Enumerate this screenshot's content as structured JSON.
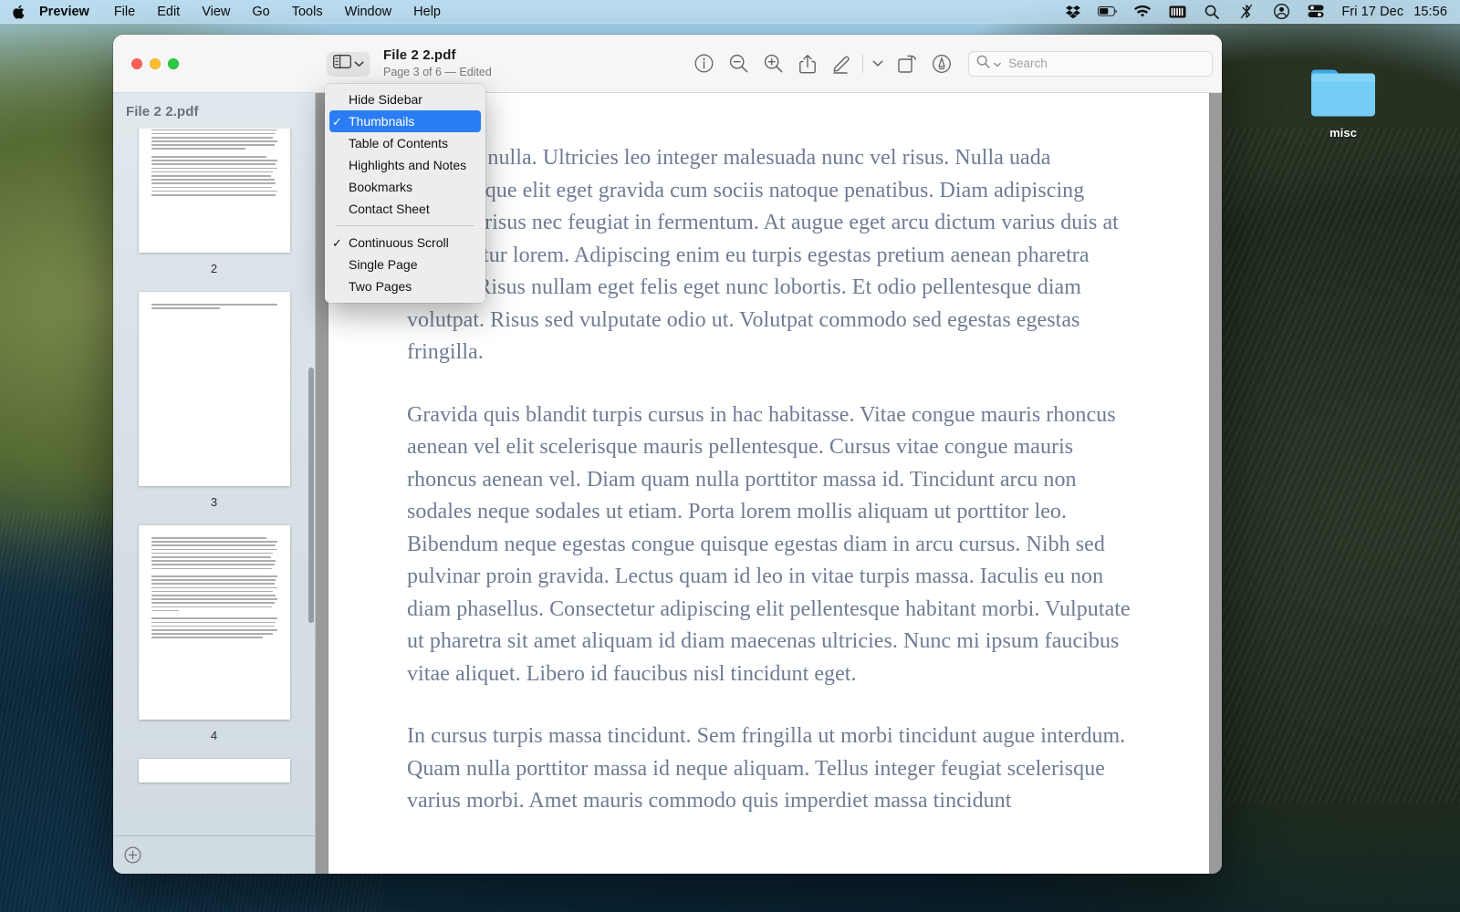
{
  "menubar": {
    "apple_icon": "apple-logo-icon",
    "items": [
      "Preview",
      "File",
      "Edit",
      "View",
      "Go",
      "Tools",
      "Window",
      "Help"
    ],
    "status_icons": [
      "dropbox-icon",
      "battery-icon",
      "wifi-icon",
      "battery-grid-icon",
      "search-icon",
      "bluetooth-off-icon",
      "user-account-icon",
      "control-center-icon"
    ],
    "date": "Fri 17 Dec",
    "time": "15:56"
  },
  "desktop": {
    "folder": {
      "label": "misc",
      "icon": "folder-icon"
    }
  },
  "window": {
    "toolbar": {
      "sidebar_toggle_icon": "sidebar-icon",
      "sidebar_toggle_chevron": "chevron-down-icon",
      "title": "File 2 2.pdf",
      "subtitle": "Page 3 of 6 — Edited",
      "actions": [
        {
          "name": "info-icon",
          "label": "Info"
        },
        {
          "name": "zoom-out-icon",
          "label": "Zoom Out"
        },
        {
          "name": "zoom-in-icon",
          "label": "Zoom In"
        },
        {
          "name": "share-icon",
          "label": "Share"
        },
        {
          "name": "markup-icon",
          "label": "Markup"
        },
        {
          "name": "chevron-down-icon",
          "label": "More"
        },
        {
          "name": "rotate-icon",
          "label": "Rotate"
        },
        {
          "name": "annotate-icon",
          "label": "Annotate"
        }
      ],
      "search": {
        "placeholder": "Search",
        "value": "",
        "icon": "search-icon",
        "chevron": "chevron-down-icon"
      }
    },
    "sidebar": {
      "title": "File 2 2.pdf",
      "thumbnails": [
        {
          "page_number": "2"
        },
        {
          "page_number": "3"
        },
        {
          "page_number": "4"
        }
      ],
      "add_button": {
        "icon": "plus-circle-icon",
        "label": "+"
      }
    },
    "document": {
      "paragraphs": [
        "ate enim nulla. Ultricies leo integer malesuada nunc vel risus. Nulla uada pellentesque elit eget gravida cum sociis natoque penatibus. Diam adipiscing tristique risus nec feugiat in fermentum. At augue eget arcu dictum varius duis at consectetur lorem. Adipiscing enim eu turpis egestas pretium aenean pharetra magna. Risus nullam eget felis eget nunc lobortis. Et odio pellentesque diam volutpat. Risus sed vulputate odio ut. Volutpat commodo sed egestas egestas fringilla.",
        "Gravida quis blandit turpis cursus in hac habitasse. Vitae congue mauris rhoncus aenean vel elit scelerisque mauris pellentesque. Cursus vitae congue mauris rhoncus aenean vel. Diam quam nulla porttitor massa id. Tincidunt arcu non sodales neque sodales ut etiam. Porta lorem mollis aliquam ut porttitor leo. Bibendum neque egestas congue quisque egestas diam in arcu cursus. Nibh sed pulvinar proin gravida. Lectus quam id leo in vitae turpis massa. Iaculis eu non diam phasellus. Consectetur adipiscing elit pellentesque habitant morbi. Vulputate ut pharetra sit amet aliquam id diam maecenas ultricies. Nunc mi ipsum faucibus vitae aliquet. Libero id faucibus nisl tincidunt eget.",
        "In cursus turpis massa tincidunt. Sem fringilla ut morbi tincidunt augue interdum. Quam nulla porttitor massa id neque aliquam. Tellus integer feugiat scelerisque varius morbi. Amet mauris commodo quis imperdiet massa tincidunt"
      ]
    }
  },
  "view_menu": {
    "items": [
      {
        "label": "Hide Sidebar",
        "checked": false,
        "selected": false
      },
      {
        "label": "Thumbnails",
        "checked": true,
        "selected": true
      },
      {
        "label": "Table of Contents",
        "checked": false,
        "selected": false
      },
      {
        "label": "Highlights and Notes",
        "checked": false,
        "selected": false
      },
      {
        "label": "Bookmarks",
        "checked": false,
        "selected": false
      },
      {
        "label": "Contact Sheet",
        "checked": false,
        "selected": false
      },
      {
        "label": "Continuous Scroll",
        "checked": true,
        "selected": false
      },
      {
        "label": "Single Page",
        "checked": false,
        "selected": false
      },
      {
        "label": "Two Pages",
        "checked": false,
        "selected": false
      }
    ],
    "separator_after_index": 5,
    "highlight_color": "#2a7df4",
    "check_glyph": "✓"
  }
}
